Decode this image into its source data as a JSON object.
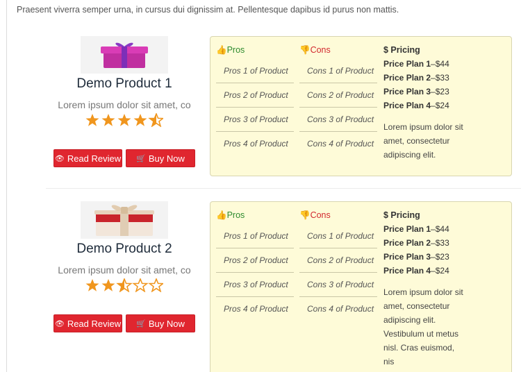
{
  "intro": {
    "line1_partial": "Praesent viverra semper urna, in cursus dui dignissim at. Pellentesque dapibus id purus non mattis."
  },
  "labels": {
    "read_review": "Read Review",
    "buy_now": "Buy Now",
    "pros_heading": "Pros",
    "cons_heading": "Cons",
    "pricing_heading": "$ Pricing"
  },
  "products": [
    {
      "name": "Demo Product 1",
      "description": "Lorem ipsum dolor sit amet, co",
      "rating": 4.5,
      "stars": "★★★★⯪",
      "pros": [
        "Pros 1 of Product",
        "Pros 2 of Product",
        "Pros 3 of Product",
        "Pros 4 of Product"
      ],
      "cons": [
        "Cons 1 of Product",
        "Cons 2 of Product",
        "Cons 3 of Product",
        "Cons 4 of Product"
      ],
      "plans": [
        {
          "name": "Price Plan 1",
          "price": "–$44"
        },
        {
          "name": "Price Plan 2",
          "price": "–$33"
        },
        {
          "name": "Price Plan 3",
          "price": "–$23"
        },
        {
          "name": "Price Plan 4",
          "price": "–$24"
        }
      ],
      "pricing_text_lines": [
        "Lorem ipsum dolor sit",
        "amet, consectetur",
        "adipiscing elit."
      ]
    },
    {
      "name": "Demo Product 2",
      "description": "Lorem ipsum dolor sit amet, co",
      "rating": 2.5,
      "stars": "★★⯪☆☆",
      "pros": [
        "Pros 1 of Product",
        "Pros 2 of Product",
        "Pros 3 of Product",
        "Pros 4 of Product"
      ],
      "cons": [
        "Cons 1 of Product",
        "Cons 2 of Product",
        "Cons 3 of Product",
        "Cons 4 of Product"
      ],
      "plans": [
        {
          "name": "Price Plan 1",
          "price": "–$44"
        },
        {
          "name": "Price Plan 2",
          "price": "–$33"
        },
        {
          "name": "Price Plan 3",
          "price": "–$23"
        },
        {
          "name": "Price Plan 4",
          "price": "–$24"
        }
      ],
      "pricing_text_lines": [
        "Lorem ipsum dolor sit",
        "amet, consectetur",
        "adipiscing elit.",
        "Vestibulum ut metus",
        "nisl. Cras euismod,",
        "nis"
      ]
    }
  ],
  "colors": {
    "button_red": "#e0262f",
    "pros_green": "#2e8b2e",
    "cons_red": "#d2282e",
    "box_bg": "#fefbd8",
    "star_orange": "#f0961e"
  }
}
